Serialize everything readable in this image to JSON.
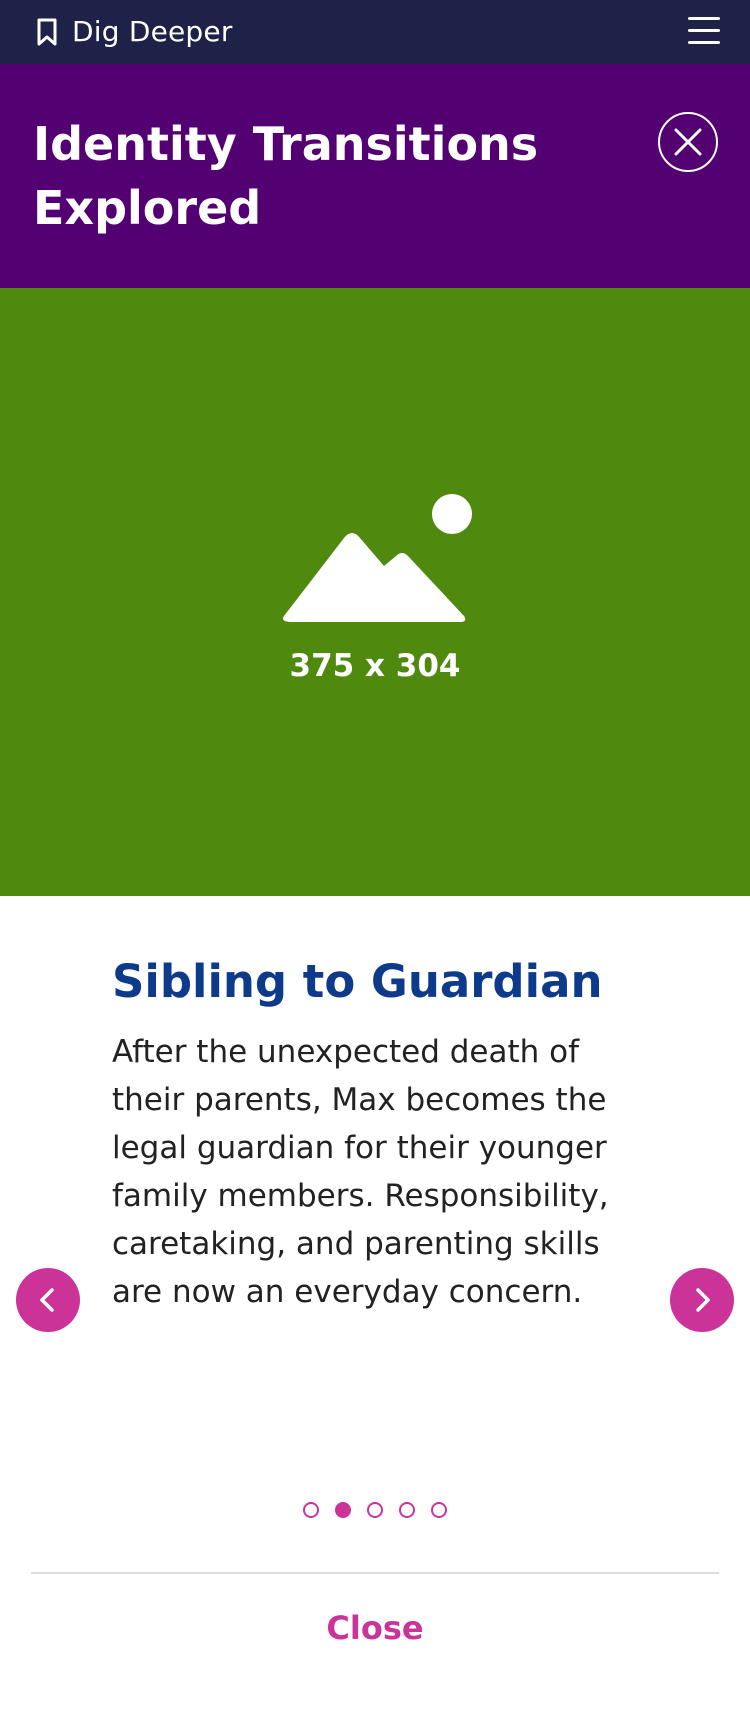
{
  "topbar": {
    "brand": "Dig Deeper",
    "icons": [
      "bookmark-icon",
      "menu-icon"
    ],
    "background": "#1e2148"
  },
  "header": {
    "title": "Identity Transitions Explored",
    "background": "#530073",
    "close_icon": "close-icon"
  },
  "image": {
    "placeholder_label": "375 x 304",
    "icon": "image-placeholder-icon",
    "background": "#4f8a0f"
  },
  "slide": {
    "title": "Sibling to Guardian",
    "body": "After the unexpected death of their parents, Max becomes the legal guardian for their younger family members. Responsibility, caretaking, and parenting skills are now an everyday concern.",
    "title_color": "#0d3a8a"
  },
  "carousel": {
    "prev_icon": "chevron-left-icon",
    "next_icon": "chevron-right-icon",
    "dot_count": 5,
    "active_index": 2,
    "accent_color": "#cc3399"
  },
  "footer": {
    "close_label": "Close"
  }
}
